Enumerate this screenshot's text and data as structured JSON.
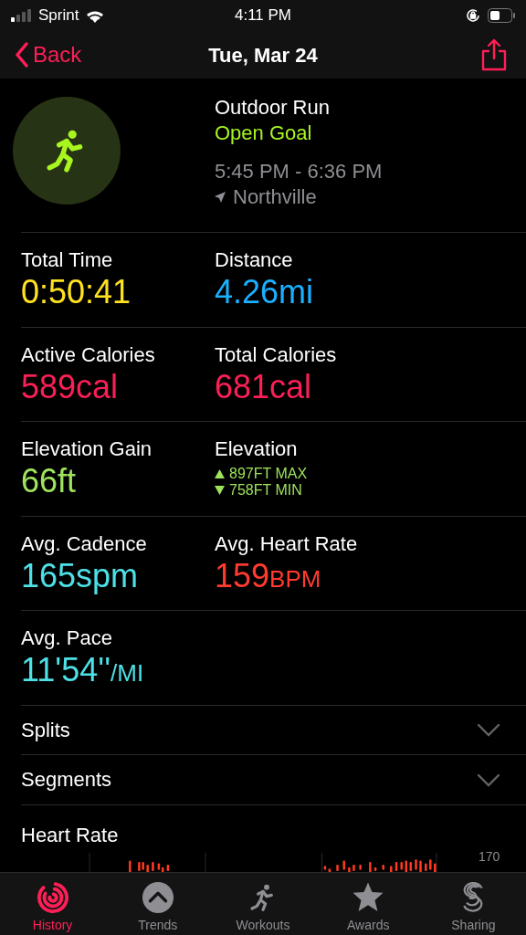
{
  "status_bar": {
    "carrier": "Sprint",
    "time": "4:11 PM"
  },
  "nav": {
    "back": "Back",
    "title": "Tue, Mar 24"
  },
  "workout": {
    "name": "Outdoor Run",
    "goal": "Open Goal",
    "time_range": "5:45 PM - 6:36 PM",
    "location": "Northville"
  },
  "metric_rows": [
    [
      {
        "kind": "value",
        "label": "Total Time",
        "value": "0:50:41",
        "color": "#ffe21f"
      },
      {
        "kind": "value",
        "label": "Distance",
        "value": "4.26",
        "unit": "mi",
        "color": "#1ab0ff"
      }
    ],
    [
      {
        "kind": "value",
        "label": "Active Calories",
        "value": "589",
        "unit": "cal",
        "color": "#fa1f56"
      },
      {
        "kind": "value",
        "label": "Total Calories",
        "value": "681",
        "unit": "cal",
        "color": "#fa1f56"
      }
    ],
    [
      {
        "kind": "value",
        "label": "Elevation Gain",
        "value": "66",
        "unit": "ft",
        "color": "#9ee35d"
      },
      {
        "kind": "range",
        "label": "Elevation",
        "max": "897FT MAX",
        "min": "758FT MIN",
        "color": "#9ee35d"
      }
    ],
    [
      {
        "kind": "value",
        "label": "Avg. Cadence",
        "value": "165",
        "unit": "spm",
        "color": "#4de0e6"
      },
      {
        "kind": "value",
        "label": "Avg. Heart Rate",
        "value": "159",
        "unit": "BPM",
        "small_unit": true,
        "color": "#ff3b2f"
      }
    ],
    [
      {
        "kind": "value",
        "label": "Avg. Pace",
        "value": "11'54''",
        "unit": "/MI",
        "small_unit": true,
        "color": "#4de0e6"
      }
    ]
  ],
  "sections": [
    {
      "label": "Splits",
      "expanded": false
    },
    {
      "label": "Segments",
      "expanded": false
    }
  ],
  "heart_rate": {
    "title": "Heart Rate",
    "axis_label": "170"
  },
  "tabs": [
    {
      "label": "History",
      "selected": true
    },
    {
      "label": "Trends",
      "selected": false
    },
    {
      "label": "Workouts",
      "selected": false
    },
    {
      "label": "Awards",
      "selected": false
    },
    {
      "label": "Sharing",
      "selected": false
    }
  ]
}
